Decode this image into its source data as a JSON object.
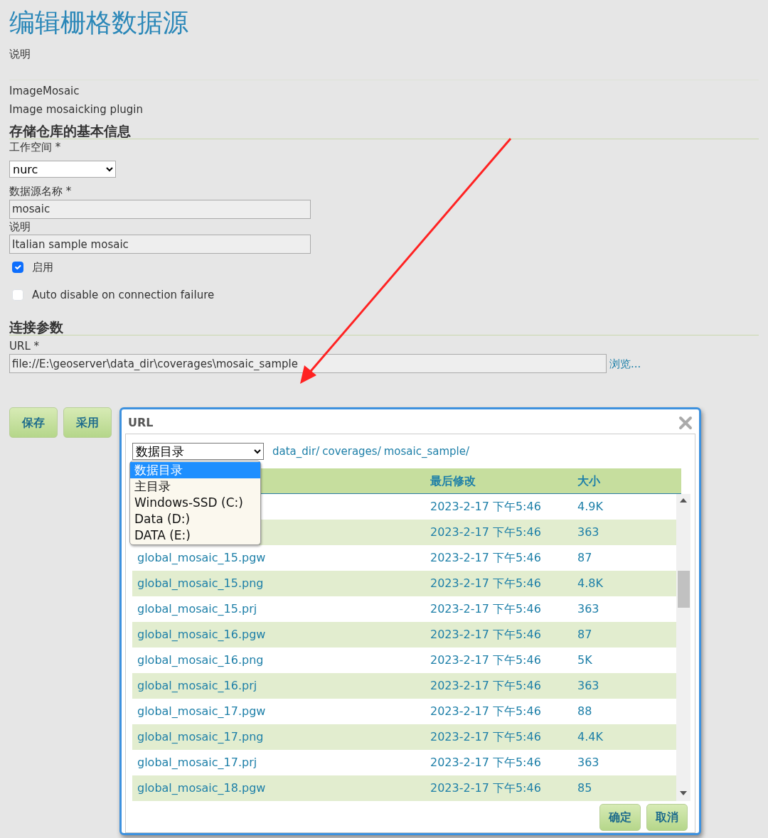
{
  "page": {
    "title": "编辑栅格数据源",
    "description_label": "说明",
    "store_type": "ImageMosaic",
    "store_description": "Image mosaicking plugin"
  },
  "basic_info": {
    "heading": "存储仓库的基本信息",
    "workspace": {
      "label": "工作空间 *",
      "value": "nurc"
    },
    "name": {
      "label": "数据源名称 *",
      "value": "mosaic"
    },
    "description": {
      "label": "说明",
      "value": "Italian sample mosaic"
    },
    "checkboxes": [
      {
        "label": "启用",
        "checked": true
      },
      {
        "label": "Auto disable on connection failure",
        "checked": false
      }
    ]
  },
  "connection": {
    "heading": "连接参数",
    "url": {
      "label": "URL *",
      "value": "file://E:\\geoserver\\data_dir\\coverages\\mosaic_sample"
    },
    "browse_link": "浏览..."
  },
  "buttons": [
    "保存",
    "采用"
  ],
  "dialog": {
    "title": "URL",
    "root_select": {
      "value": "数据目录",
      "options": [
        {
          "label": "数据目录",
          "selected": true
        },
        {
          "label": "主目录",
          "selected": false
        },
        {
          "label": "Windows-SSD (C:)",
          "selected": false
        },
        {
          "label": "Data (D:)",
          "selected": false
        },
        {
          "label": "DATA (E:)",
          "selected": false
        }
      ]
    },
    "breadcrumb": [
      "data_dir/",
      "coverages/",
      "mosaic_sample/"
    ],
    "columns": {
      "column_2": "最后修改",
      "column_3": "大小"
    },
    "rows": [
      {
        "modified": "2023-2-17 下午5:46",
        "size": "4.9K"
      },
      {
        "modified": "2023-2-17 下午5:46",
        "size": "363"
      },
      {
        "name": "global_mosaic_15.pgw",
        "modified": "2023-2-17 下午5:46",
        "size": "87"
      },
      {
        "name": "global_mosaic_15.png",
        "modified": "2023-2-17 下午5:46",
        "size": "4.8K"
      },
      {
        "name": "global_mosaic_15.prj",
        "modified": "2023-2-17 下午5:46",
        "size": "363"
      },
      {
        "name": "global_mosaic_16.pgw",
        "modified": "2023-2-17 下午5:46",
        "size": "87"
      },
      {
        "name": "global_mosaic_16.png",
        "modified": "2023-2-17 下午5:46",
        "size": "5K"
      },
      {
        "name": "global_mosaic_16.prj",
        "modified": "2023-2-17 下午5:46",
        "size": "363"
      },
      {
        "name": "global_mosaic_17.pgw",
        "modified": "2023-2-17 下午5:46",
        "size": "88"
      },
      {
        "name": "global_mosaic_17.png",
        "modified": "2023-2-17 下午5:46",
        "size": "4.4K"
      },
      {
        "name": "global_mosaic_17.prj",
        "modified": "2023-2-17 下午5:46",
        "size": "363"
      },
      {
        "name": "global_mosaic_18.pgw",
        "modified": "2023-2-17 下午5:46",
        "size": "85"
      }
    ],
    "buttons": [
      "确定",
      "取消"
    ]
  }
}
